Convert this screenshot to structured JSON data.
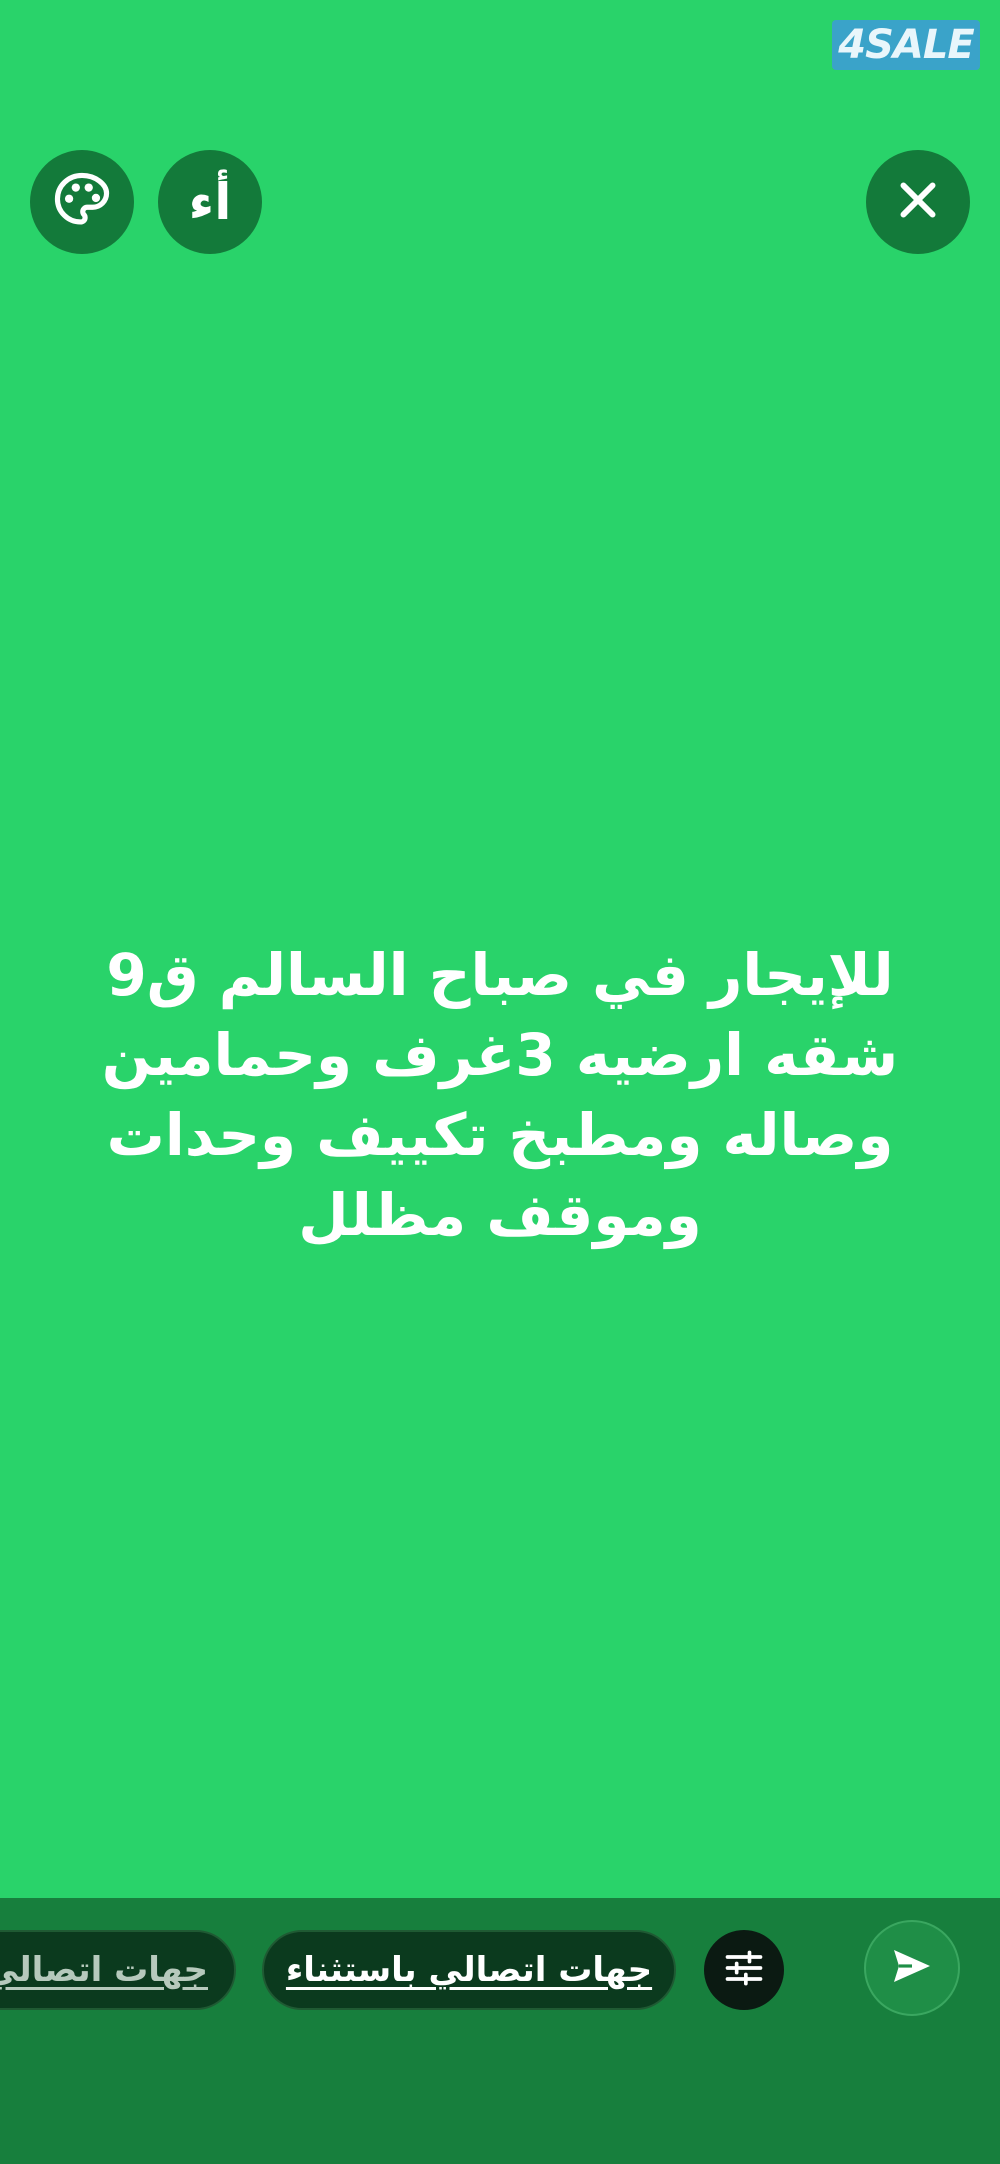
{
  "watermark": {
    "text": "4SALE"
  },
  "toolbar": {
    "palette_icon": "palette-icon",
    "text_style_label": "أء",
    "close_icon": "close-icon"
  },
  "status": {
    "text": "للإيجار في صباح السالم ق9 شقه ارضيه 3غرف وحمامين وصاله ومطبخ تكييف وحدات وموقف مظلل"
  },
  "audience": {
    "chips": [
      {
        "label": "جهات اتصالي"
      },
      {
        "label": "جهات اتصالي باستثناء"
      }
    ],
    "filter_icon": "sliders-icon"
  },
  "send": {
    "icon": "send-icon"
  },
  "colors": {
    "background": "#29d36a",
    "bottom_bar": "#177f3d",
    "button": "#137a3a",
    "chip": "#0b3a1e"
  }
}
